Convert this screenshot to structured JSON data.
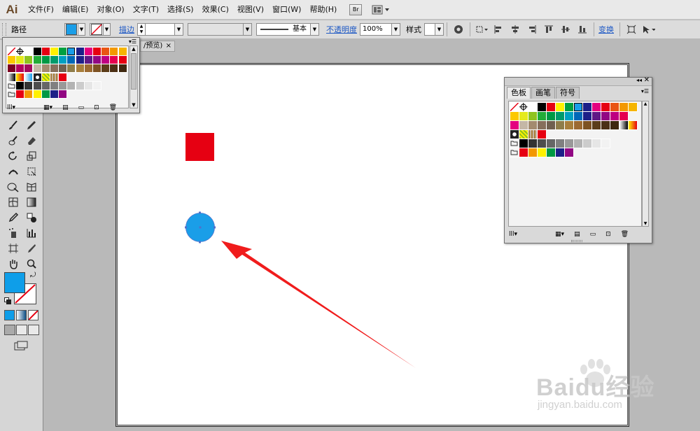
{
  "app": {
    "logo": "Ai"
  },
  "menu": [
    "文件(F)",
    "编辑(E)",
    "对象(O)",
    "文字(T)",
    "选择(S)",
    "效果(C)",
    "视图(V)",
    "窗口(W)",
    "帮助(H)"
  ],
  "menubar_extras": {
    "bridge_label": "Br"
  },
  "control_bar": {
    "object_type": "路径",
    "fill_color": "#1a9ee8",
    "stroke_color": "none",
    "stroke_label": "描边",
    "stroke_weight": "",
    "profile": "基本",
    "opacity_label": "不透明度",
    "opacity_value": "100%",
    "style_label": "样式",
    "transform_label": "变换"
  },
  "document_tab": {
    "title": "/预览)",
    "close": "×"
  },
  "tools_panel": {
    "fill_color": "#0e9ee9",
    "stroke_color": "none"
  },
  "artwork": {
    "square_color": "#e60012",
    "circle_color": "#1a9ee8",
    "arrow_color": "#f01c1c"
  },
  "swatch_flyout": {
    "rows": [
      [
        "none",
        "reg",
        "#ffffff",
        "#000000",
        "#e60012",
        "#fff100",
        "#00a040",
        "#1a9ee8",
        "#1d2088",
        "#e4007f",
        "#e60012",
        "#e95513",
        "#f39800",
        "#f6b500"
      ],
      [
        "#fcc800",
        "#e5ea1c",
        "#8fc31f",
        "#22ac38",
        "#009944",
        "#009b6b",
        "#00a0c1",
        "#0068b7",
        "#1d2088",
        "#601986",
        "#920783",
        "#be0081",
        "#e5004f",
        "#e60012"
      ],
      [
        "#7d0022",
        "#b3005e",
        "#a40b5d",
        "#c4b7a6",
        "#a38b6f",
        "#866f5c",
        "#706050",
        "#8f7d4a",
        "#a87f3c",
        "#9c6a31",
        "#7d5222",
        "#5c3d1a",
        "#4b2f15",
        "#3f2810"
      ],
      [
        "grad1",
        "grad2",
        "grad3",
        "pat1",
        "pat2",
        "pat3",
        "#e60012"
      ],
      [
        "folder",
        "#000000",
        "#333333",
        "#4d4d4d",
        "#666666",
        "#808080",
        "#999999",
        "#b3b3b3",
        "#cccccc",
        "#e6e6e6",
        "#f2f2f2"
      ],
      [
        "folder",
        "#e60012",
        "#f39800",
        "#fff100",
        "#009944",
        "#1d2088",
        "#920783"
      ]
    ]
  },
  "swatch_panel": {
    "tabs": [
      "色板",
      "画笔",
      "符号"
    ],
    "rows": [
      [
        "none",
        "reg",
        "#ffffff",
        "#000000",
        "#e60012",
        "#fff100",
        "#00a040",
        "#1a9ee8",
        "#1d2088",
        "#e4007f",
        "#e60012",
        "#e95513",
        "#f39800",
        "#f6b500"
      ],
      [
        "#fcc800",
        "#e5ea1c",
        "#8fc31f",
        "#22ac38",
        "#009944",
        "#009b6b",
        "#00a0c1",
        "#0068b7",
        "#1d2088",
        "#601986",
        "#920783",
        "#be0081",
        "#e5004f"
      ],
      [
        "#e4007f",
        "#c4b7a6",
        "#a38b6f",
        "#866f5c",
        "#706050",
        "#8f7d4a",
        "#a87f3c",
        "#9c6a31",
        "#7d5222",
        "#5c3d1a",
        "#4b2f15",
        "#3f2810",
        "grad1",
        "grad2"
      ],
      [
        "pat1",
        "pat2",
        "pat3",
        "#e60012"
      ],
      [
        "folder",
        "#000000",
        "#333333",
        "#4d4d4d",
        "#666666",
        "#808080",
        "#999999",
        "#b3b3b3",
        "#cccccc",
        "#e6e6e6",
        "#f2f2f2"
      ],
      [
        "folder",
        "#e60012",
        "#f39800",
        "#fff100",
        "#009944",
        "#1d2088",
        "#920783"
      ]
    ]
  },
  "watermark": {
    "brand": "Baidu经验",
    "url": "jingyan.baidu.com"
  }
}
